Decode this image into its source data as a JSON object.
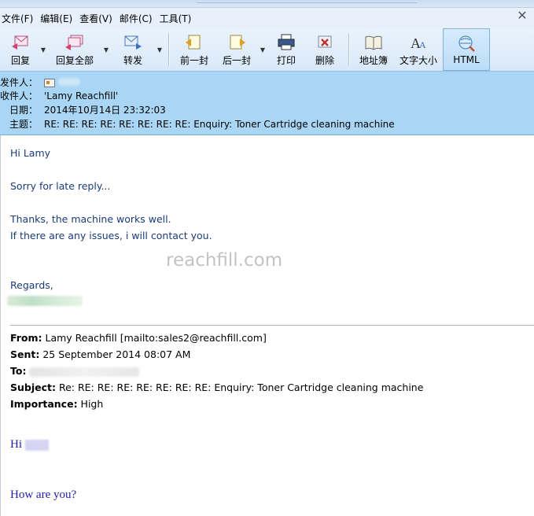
{
  "window": {
    "close_glyph": "✕"
  },
  "menu": {
    "items": [
      "文件(F)",
      "编辑(E)",
      "查看(V)",
      "邮件(C)",
      "工具(T)"
    ]
  },
  "toolbar": {
    "reply": "回复",
    "reply_all": "回复全部",
    "forward": "转发",
    "previous": "前一封",
    "next": "后一封",
    "print": "打印",
    "delete": "删除",
    "address_book": "地址簿",
    "text_size": "文字大小",
    "html": "HTML"
  },
  "header": {
    "from_label": "发件人：",
    "to_label": "收件人：",
    "to_value": "'Lamy Reachfill'",
    "date_label": "日期：",
    "date_value": "2014年10月14日 23:32:03",
    "subject_label": "主题：",
    "subject_value": "RE: RE: RE: RE: RE: RE: RE: RE: Enquiry: Toner Cartridge cleaning machine"
  },
  "body": {
    "greeting": "Hi Lamy",
    "line1": "Sorry for late reply...",
    "line2": "Thanks,  the machine works well.",
    "line3": "If there are any issues, i will contact you.",
    "watermark": "reachfill.com",
    "regards": "Regards,"
  },
  "quoted": {
    "from_label": "From:",
    "from_value": " Lamy Reachfill [mailto:sales2@reachfill.com]",
    "sent_label": "Sent:",
    "sent_value": " 25 September 2014 08:07 AM",
    "to_label": "To:",
    "subject_label": "Subject:",
    "subject_value": " Re: RE: RE: RE: RE: RE: RE: RE: Enquiry: Toner Cartridge cleaning machine",
    "importance_label": "Importance:",
    "importance_value": " High",
    "hi": "Hi",
    "how_are_you": "How are you?"
  },
  "colors": {
    "header_bg": "#a9d6f4",
    "body_text": "#1a3c78",
    "quoted_serif_text": "#1f1fa0"
  }
}
